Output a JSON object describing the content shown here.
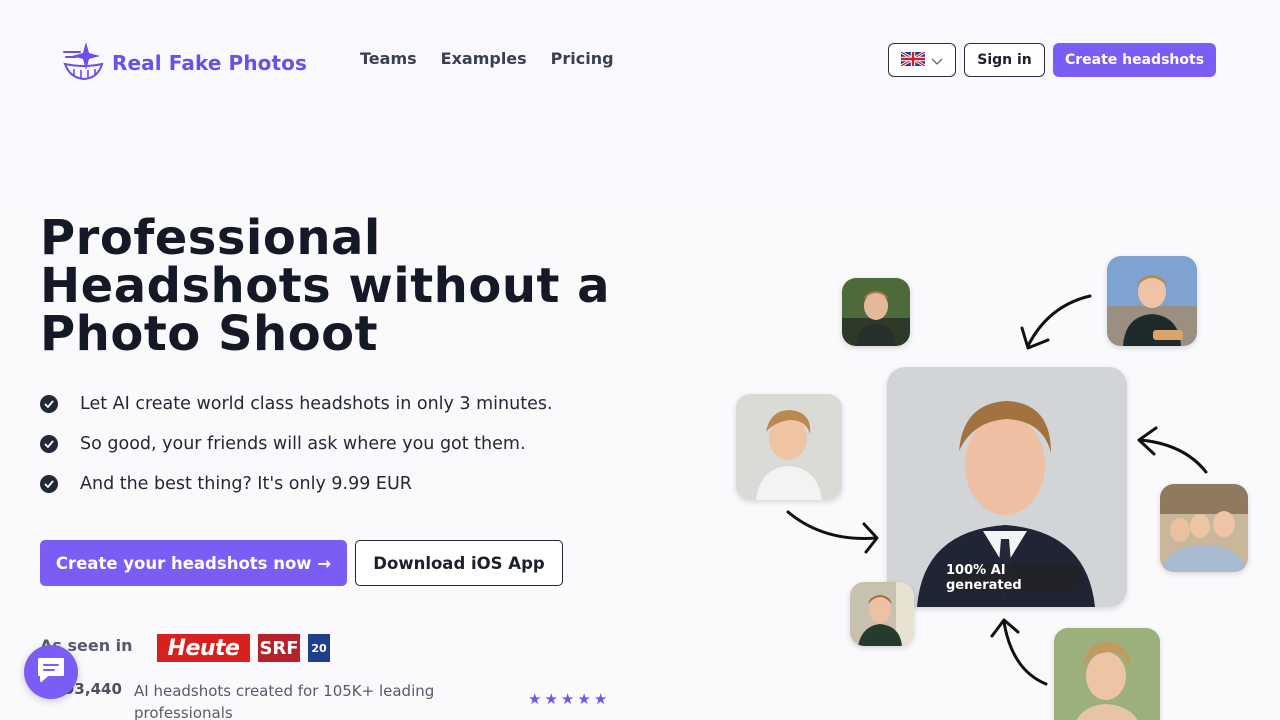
{
  "brand": {
    "name": "Real Fake Photos",
    "accent_color": "#7b5cf5",
    "logo_icon": "sparkle-smile-icon"
  },
  "nav": {
    "items": [
      {
        "label": "Teams"
      },
      {
        "label": "Examples"
      },
      {
        "label": "Pricing"
      }
    ]
  },
  "header": {
    "language_flag": "uk-flag-icon",
    "sign_in_label": "Sign in",
    "create_label": "Create headshots"
  },
  "hero": {
    "title": "Professional Headshots without a Photo Shoot",
    "bullets": [
      "Let AI create world class headshots in only 3 minutes.",
      "So good, your friends will ask where you got them.",
      "And the best thing? It's only 9.99 EUR"
    ],
    "cta_primary": "Create your headshots now →",
    "cta_secondary": "Download iOS App"
  },
  "press": {
    "label": "As seen in",
    "logos": [
      "Heute",
      "SRF",
      "20"
    ]
  },
  "stats": {
    "count": "93,440",
    "text": "AI headshots created for 105K+ leading professionals",
    "rating_stars": 5
  },
  "gallery": {
    "badge": "100% AI generated"
  },
  "chat": {
    "icon": "chat-icon"
  }
}
